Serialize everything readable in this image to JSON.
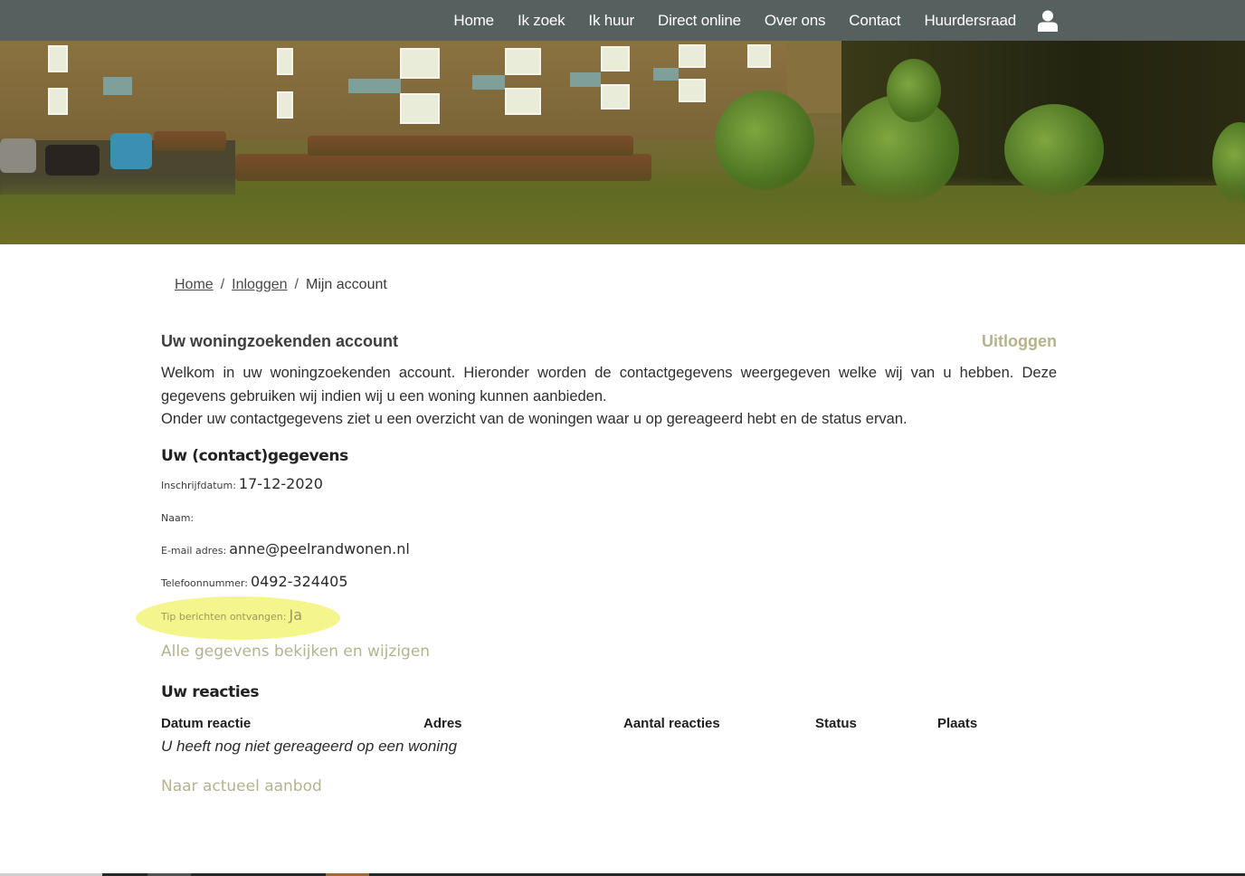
{
  "nav": {
    "items": [
      {
        "label": "Home"
      },
      {
        "label": "Ik zoek"
      },
      {
        "label": "Ik huur"
      },
      {
        "label": "Direct online"
      },
      {
        "label": "Over ons"
      },
      {
        "label": "Contact"
      },
      {
        "label": "Huurdersraad"
      }
    ],
    "user_icon": "user-icon"
  },
  "hero": {
    "image": "apartment-buildings-garden-photo"
  },
  "breadcrumb": {
    "items": [
      {
        "label": "Home"
      },
      {
        "label": "Inloggen"
      },
      {
        "label": "Mijn account"
      }
    ],
    "separator": "/"
  },
  "account": {
    "title": "Uw woningzoekenden account",
    "logout_label": "Uitloggen",
    "intro_line1": "Welkom in uw woningzoekenden account. Hieronder worden de contactgegevens weergegeven welke wij van u hebben. Deze gegevens gebruiken wij indien wij u een woning kunnen aanbieden.",
    "intro_line2": "Onder uw contactgegevens ziet u een overzicht van de woningen waar u op gereageerd hebt en de status ervan."
  },
  "contact": {
    "title": "Uw (contact)gegevens",
    "fields": [
      {
        "label": "Inschrijfdatum:",
        "value": "17-12-2020"
      },
      {
        "label": "Naam:",
        "value": ""
      },
      {
        "label": "E-mail adres:",
        "value": "anne@peelrandwonen.nl"
      },
      {
        "label": "Telefoonnummer:",
        "value": "0492-324405"
      },
      {
        "label": "Tip berichten ontvangen:",
        "value": "Ja"
      }
    ],
    "edit_link": "Alle gegevens bekijken en wijzigen"
  },
  "reactions": {
    "title": "Uw reacties",
    "columns": [
      "Datum reactie",
      "Adres",
      "Aantal reacties",
      "Status",
      "Plaats"
    ],
    "empty_message": "U heeft nog niet gereageerd op een woning",
    "offer_link": "Naar actueel aanbod"
  },
  "colors": {
    "nav_bg": "#56605e",
    "accent_link": "#b5b38a",
    "highlight": "#f3f37a"
  }
}
